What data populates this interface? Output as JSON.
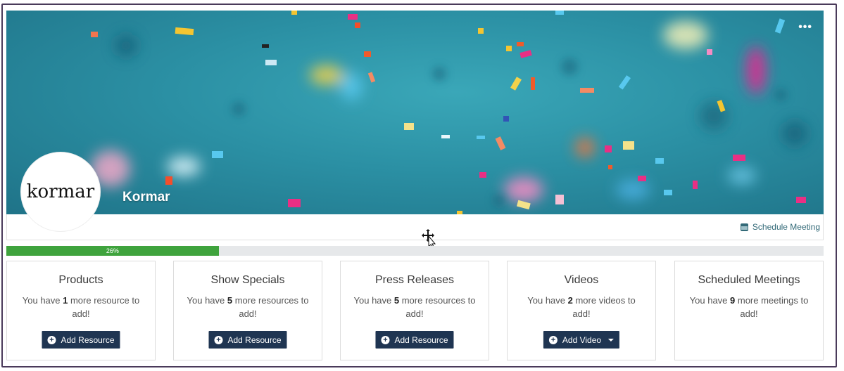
{
  "company": {
    "name": "Kormar",
    "logo_text": "kormar",
    "more_icon": "ellipsis-icon"
  },
  "schedule": {
    "label": "Schedule Meeting",
    "icon": "calendar-icon"
  },
  "progress": {
    "label": "26%",
    "value": 26,
    "color": "#3fa33d"
  },
  "cards": [
    {
      "title": "Products",
      "msg_prefix": "You have ",
      "count": "1",
      "msg_suffix": " more resource to add!",
      "button": "Add Resource"
    },
    {
      "title": "Show Specials",
      "msg_prefix": "You have ",
      "count": "5",
      "msg_suffix": " more resources to add!",
      "button": "Add Resource"
    },
    {
      "title": "Press Releases",
      "msg_prefix": "You have ",
      "count": "5",
      "msg_suffix": " more resources to add!",
      "button": "Add Resource"
    },
    {
      "title": "Videos",
      "msg_prefix": "You have ",
      "count": "2",
      "msg_suffix": " more videos to add!",
      "button": "Add Video"
    },
    {
      "title": "Scheduled Meetings",
      "msg_prefix": "You have ",
      "count": "9",
      "msg_suffix": " more meetings to add!"
    }
  ],
  "colors": {
    "button_bg": "#1f3552",
    "hero_teal": "#2b90a4",
    "link": "#336a78"
  }
}
